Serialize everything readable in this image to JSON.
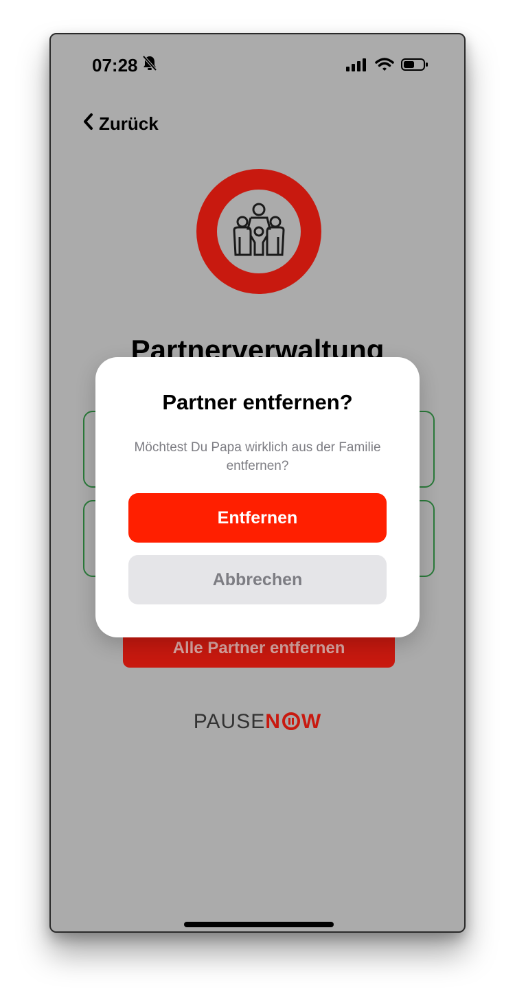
{
  "status_bar": {
    "time": "07:28",
    "icons": [
      "bell-slash-icon",
      "signal-icon",
      "wifi-icon",
      "battery-icon"
    ]
  },
  "nav": {
    "back_label": "Zurück"
  },
  "page": {
    "title": "Partnerverwaltung",
    "remove_all_label": "Alle Partner entfernen",
    "hero_icon": "family-icon"
  },
  "brand": {
    "part1": "PAUSE",
    "part2": "N",
    "part3": "W"
  },
  "dialog": {
    "title": "Partner entfernen?",
    "message": "Möchtest Du Papa wirklich aus der Familie entfernen?",
    "confirm_label": "Entfernen",
    "cancel_label": "Abbrechen"
  },
  "colors": {
    "overlay_gray": "#ababab",
    "brand_red": "#c8190f",
    "danger": "#ff1f00",
    "card_border": "#2a7a3a",
    "secondary_bg": "#e5e5e8"
  }
}
